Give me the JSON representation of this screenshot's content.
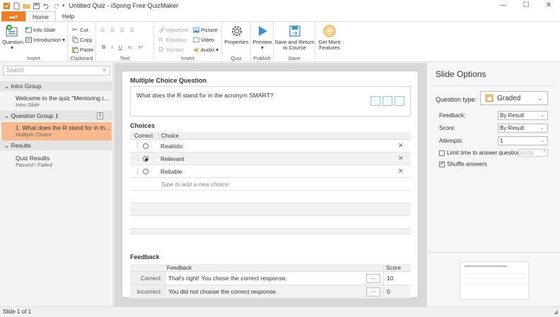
{
  "window": {
    "title": "Untitled Quiz - iSpring Free QuizMaker",
    "controls": [
      "—",
      "☐",
      "✕"
    ]
  },
  "tabs": {
    "menu_glyph": "▬▾",
    "items": [
      "Home",
      "Help"
    ],
    "active": "Home"
  },
  "ribbon": {
    "insert": {
      "label": "Insert",
      "question": "Question",
      "info_slide": "Info Slide",
      "introduction": "Introduction ▾"
    },
    "clipboard": {
      "label": "Clipboard",
      "cut": "Cut",
      "copy": "Copy",
      "paste": "Paste"
    },
    "text": {
      "label": "Text",
      "bold": "B",
      "italic": "I",
      "underline": "U",
      "sub": "x₂",
      "sup": "x²"
    },
    "insert2": {
      "label": "Insert",
      "hyperlink": "Hyperlink",
      "equation": "Equation",
      "symbol": "Symbol",
      "picture": "Picture",
      "video": "Video",
      "audio": "Audio ▾"
    },
    "quiz": {
      "label": "Quiz",
      "properties": "Properties"
    },
    "publish": {
      "label": "Publish",
      "preview": "Preview"
    },
    "save": {
      "label": "Save",
      "save_return": "Save and Return",
      "to_course": "to Course"
    },
    "more": {
      "get_more": "Get More",
      "features": "Features"
    }
  },
  "sidebar": {
    "search_placeholder": "Search",
    "groups": [
      {
        "name": "Intro Group",
        "items": [
          {
            "title": "Welcome to the quiz \"Mentoring i...",
            "sub": "Intro Slide"
          }
        ]
      },
      {
        "name": "Question Group 1",
        "count": "1",
        "items": [
          {
            "title": "1. What does the R stand for in th...",
            "sub": "Multiple Choice"
          }
        ]
      },
      {
        "name": "Results",
        "items": [
          {
            "title": "Quiz Results",
            "sub": "Passed / Failed"
          }
        ]
      }
    ]
  },
  "editor": {
    "heading": "Multiple Choice Question",
    "question_text": "What does the R stand for in the acronym SMART?",
    "choices": {
      "heading": "Choices",
      "col_correct": "Correct",
      "col_choice": "Choice",
      "rows": [
        {
          "text": "Realistic",
          "correct": false
        },
        {
          "text": "Relevant",
          "correct": true
        },
        {
          "text": "Reliable",
          "correct": false
        }
      ],
      "add_placeholder": "Type to add a new choice"
    },
    "feedback": {
      "heading": "Feedback",
      "col_feedback": "Feedback",
      "col_score": "Score",
      "rows": [
        {
          "label": "Correct:",
          "text": "That's right! You chose the correct response.",
          "score": "10"
        },
        {
          "label": "Incorrect:",
          "text": "You did not choose the correct response.",
          "score": "0"
        }
      ],
      "dots": "···"
    }
  },
  "options": {
    "title": "Slide Options",
    "question_type_label": "Question type:",
    "question_type_value": "Graded",
    "feedback_label": "Feedback:",
    "feedback_value": "By Result",
    "score_label": "Score:",
    "score_value": "By Result",
    "attempts_label": "Attempts:",
    "attempts_value": "1",
    "limit_time_label": "Limit time to answer question:",
    "limit_time_value": "01:00",
    "limit_time_checked": false,
    "shuffle_label": "Shuffle answers",
    "shuffle_checked": true
  },
  "status": {
    "text": "Slide 1 of 1"
  },
  "colors": {
    "accent": "#ef7d22",
    "selected_slide": "#f9b98f",
    "blue_icon": "#3d8fd6"
  }
}
